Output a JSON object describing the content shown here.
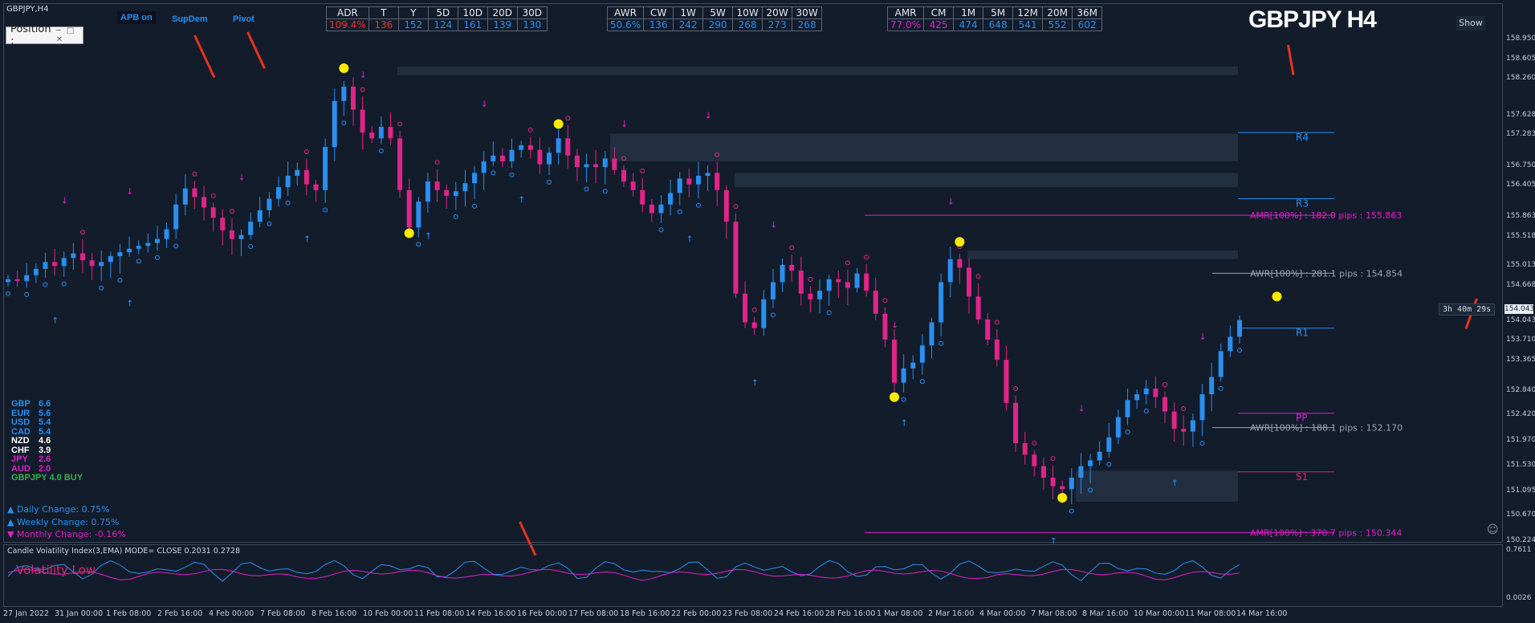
{
  "symbol_title": "GBPJPY,H4",
  "position_panel": {
    "label": "Position :",
    "buttons": "─ □ ✕"
  },
  "toggles": {
    "apb": "APB on",
    "supdem": "SupDem",
    "pivot": "Pivot"
  },
  "big_title": "GBPJPY H4",
  "show_button": "Show",
  "timer": "3h 40m 29s",
  "current_price": "154.043",
  "colors": {
    "bull": "#2a8ff0",
    "bear": "#e0248a",
    "accent_arrow": "#e8321f",
    "background": "#131c2b"
  },
  "stats_tables": [
    {
      "headers": [
        "ADR",
        "T",
        "Y",
        "5D",
        "10D",
        "20D",
        "30D"
      ],
      "values": [
        "109.4%",
        "136",
        "152",
        "124",
        "161",
        "139",
        "130"
      ],
      "value_colors": [
        "#ff2a2a",
        "#ff2a2a",
        "#2a8ff0",
        "#2a8ff0",
        "#2a8ff0",
        "#2a8ff0",
        "#2a8ff0"
      ]
    },
    {
      "headers": [
        "AWR",
        "CW",
        "1W",
        "5W",
        "10W",
        "20W",
        "30W"
      ],
      "values": [
        "50.6%",
        "136",
        "242",
        "290",
        "268",
        "273",
        "268"
      ],
      "value_colors": [
        "#2a8ff0",
        "#2a8ff0",
        "#2a8ff0",
        "#2a8ff0",
        "#2a8ff0",
        "#2a8ff0",
        "#2a8ff0"
      ]
    },
    {
      "headers": [
        "AMR",
        "CM",
        "1M",
        "5M",
        "12M",
        "20M",
        "36M"
      ],
      "values": [
        "77.0%",
        "425",
        "474",
        "648",
        "541",
        "552",
        "602"
      ],
      "value_colors": [
        "#e020c8",
        "#e020c8",
        "#2a8ff0",
        "#2a8ff0",
        "#2a8ff0",
        "#2a8ff0",
        "#2a8ff0"
      ]
    }
  ],
  "currency_strength": [
    {
      "ccy": "GBP",
      "val": "6.6",
      "color": "#2a8ff0"
    },
    {
      "ccy": "EUR",
      "val": "5.6",
      "color": "#2a8ff0"
    },
    {
      "ccy": "USD",
      "val": "5.4",
      "color": "#2a8ff0"
    },
    {
      "ccy": "CAD",
      "val": "5.4",
      "color": "#2a8ff0"
    },
    {
      "ccy": "NZD",
      "val": "4.6",
      "color": "#ffffff"
    },
    {
      "ccy": "CHF",
      "val": "3.9",
      "color": "#ffffff"
    },
    {
      "ccy": "JPY",
      "val": "2.6",
      "color": "#e020c8"
    },
    {
      "ccy": "AUD",
      "val": "2.0",
      "color": "#e020c8"
    }
  ],
  "signal": "GBPJPY 4.0 BUY",
  "changes": [
    {
      "arrow": "▲",
      "text": "Daily Change: 0.75%",
      "color": "#2a8ff0"
    },
    {
      "arrow": "▲",
      "text": "Weekly Change: 0.75%",
      "color": "#2a8ff0"
    },
    {
      "arrow": "▼",
      "text": "Monthly Change: -0.16%",
      "color": "#e020c8"
    }
  ],
  "sub_indicator": {
    "title": "Candle Volatility Index(3,EMA) MODE= CLOSE 0.2031 0.2728",
    "status": "Volatility Low",
    "axis_top": "0.7611",
    "axis_bottom": "0.0026"
  },
  "chart_data": {
    "type": "candlestick",
    "symbol": "GBPJPY",
    "timeframe": "H4",
    "ylim": [
      150.224,
      158.95
    ],
    "y_ticks": [
      "158.950",
      "158.605",
      "158.260",
      "157.628",
      "157.283",
      "156.750",
      "156.405",
      "155.863",
      "155.518",
      "155.013",
      "154.668",
      "154.043",
      "153.710",
      "153.365",
      "152.840",
      "152.420",
      "151.970",
      "151.530",
      "151.095",
      "150.670",
      "150.224"
    ],
    "x_labels": [
      "27 Jan 2022",
      "31 Jan 00:00",
      "1 Feb 08:00",
      "2 Feb 16:00",
      "4 Feb 00:00",
      "7 Feb 08:00",
      "8 Feb 16:00",
      "10 Feb 00:00",
      "11 Feb 08:00",
      "14 Feb 16:00",
      "16 Feb 00:00",
      "17 Feb 08:00",
      "18 Feb 16:00",
      "22 Feb 00:00",
      "23 Feb 08:00",
      "24 Feb 16:00",
      "28 Feb 16:00",
      "1 Mar 08:00",
      "2 Mar 16:00",
      "4 Mar 00:00",
      "7 Mar 08:00",
      "8 Mar 16:00",
      "10 Mar 00:00",
      "11 Mar 08:00",
      "14 Mar 16:00"
    ],
    "closes": [
      154.75,
      154.72,
      154.82,
      154.93,
      155.05,
      154.98,
      155.12,
      155.2,
      155.08,
      154.98,
      155.05,
      155.15,
      155.22,
      155.28,
      155.33,
      155.38,
      155.45,
      155.62,
      156.05,
      156.33,
      156.18,
      156.0,
      155.82,
      155.6,
      155.45,
      155.52,
      155.75,
      155.95,
      156.15,
      156.35,
      156.55,
      156.65,
      156.4,
      156.3,
      157.05,
      157.85,
      158.1,
      157.7,
      157.3,
      157.2,
      157.4,
      157.2,
      156.3,
      155.65,
      156.1,
      156.45,
      156.3,
      156.2,
      156.28,
      156.42,
      156.6,
      156.8,
      156.9,
      156.8,
      157.0,
      157.08,
      157.0,
      156.75,
      156.95,
      157.2,
      156.9,
      156.7,
      156.75,
      156.7,
      156.85,
      156.65,
      156.45,
      156.3,
      156.05,
      155.9,
      156.05,
      156.25,
      156.5,
      156.4,
      156.55,
      156.6,
      156.3,
      155.75,
      154.5,
      154.0,
      153.9,
      154.4,
      154.7,
      155.0,
      154.9,
      154.5,
      154.4,
      154.55,
      154.75,
      154.7,
      154.6,
      154.85,
      154.55,
      154.15,
      153.7,
      152.95,
      153.2,
      153.3,
      153.6,
      154.0,
      154.7,
      155.1,
      154.95,
      154.45,
      154.05,
      153.7,
      153.35,
      152.6,
      151.9,
      151.7,
      151.5,
      151.3,
      151.15,
      151.1,
      151.3,
      151.5,
      151.6,
      151.75,
      152.0,
      152.35,
      152.65,
      152.75,
      152.85,
      152.7,
      152.45,
      152.15,
      152.1,
      152.3,
      152.75,
      153.05,
      153.5,
      153.75,
      154.04
    ],
    "levels": [
      {
        "label": "R4",
        "value": 157.3,
        "color": "#2a8ff0"
      },
      {
        "label": "R3",
        "value": 156.15,
        "color": "#2a8ff0"
      },
      {
        "label": "R1",
        "value": 153.9,
        "color": "#2a8ff0"
      },
      {
        "label": "PP",
        "value": 152.42,
        "color": "#e020c8"
      },
      {
        "label": "S1",
        "value": 151.4,
        "color": "#e0246f"
      }
    ],
    "range_lines": [
      {
        "label": "AMR[100%] : 182.0 pips : 155.863",
        "value": 155.863,
        "color": "#e020c8"
      },
      {
        "label": "AWR[100%] : 281.1 pips : 154.854",
        "value": 154.854,
        "color": "#9aa4b0"
      },
      {
        "label": "AWR[100%] : 188.1 pips : 152.170",
        "value": 152.17,
        "color": "#9aa4b0"
      },
      {
        "label": "AMR[100%] : 370.7 pips : 150.344",
        "value": 150.344,
        "color": "#e020c8"
      }
    ],
    "supdem_zones": [
      {
        "low": 158.3,
        "high": 158.45
      },
      {
        "low": 156.8,
        "high": 157.28
      },
      {
        "low": 156.35,
        "high": 156.6
      },
      {
        "low": 155.1,
        "high": 155.25
      },
      {
        "low": 150.88,
        "high": 151.42
      }
    ],
    "stars": [
      {
        "i": 36,
        "price": 158.42
      },
      {
        "i": 59,
        "price": 157.45
      },
      {
        "i": 43,
        "price": 155.55
      },
      {
        "i": 102,
        "price": 155.4
      },
      {
        "i": 95,
        "price": 152.7
      },
      {
        "i": 113,
        "price": 150.95
      },
      {
        "i": 136,
        "price": 154.45
      }
    ]
  }
}
